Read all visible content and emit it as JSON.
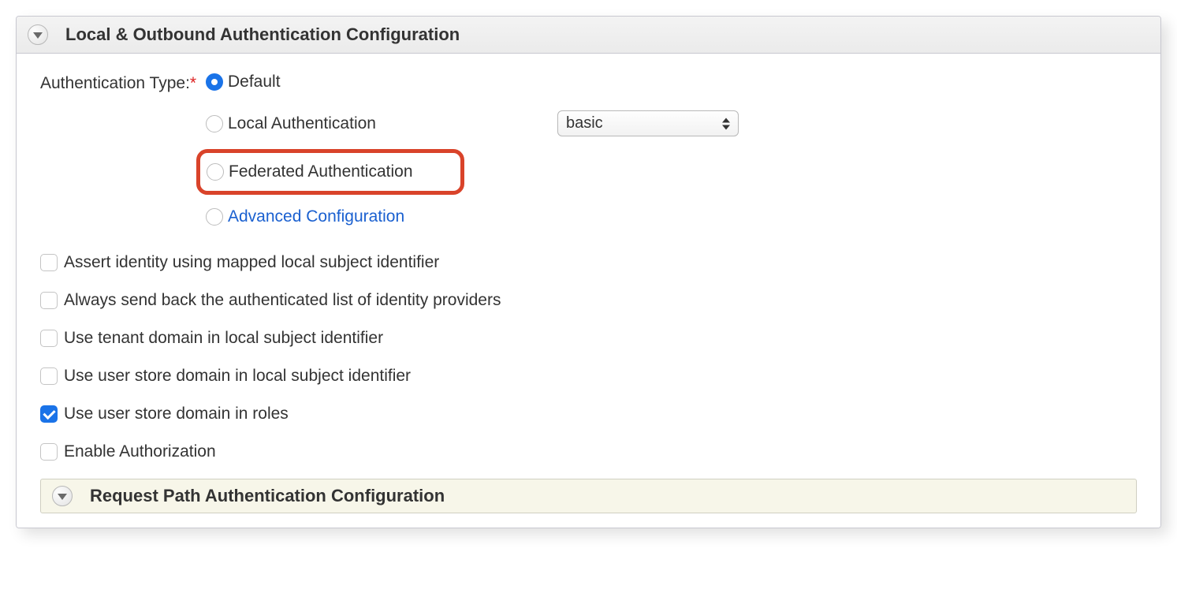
{
  "header": {
    "title": "Local & Outbound Authentication Configuration"
  },
  "form": {
    "auth_type_label": "Authentication Type:",
    "required_mark": "*",
    "options": {
      "default": "Default",
      "local": "Local Authentication",
      "federated": "Federated Authentication",
      "advanced": "Advanced Configuration"
    },
    "selected_option": "default",
    "local_select_value": "basic"
  },
  "checkboxes": [
    {
      "key": "assert_identity",
      "label": "Assert identity using mapped local subject identifier",
      "checked": false
    },
    {
      "key": "send_idp_list",
      "label": "Always send back the authenticated list of identity providers",
      "checked": false
    },
    {
      "key": "tenant_domain",
      "label": "Use tenant domain in local subject identifier",
      "checked": false
    },
    {
      "key": "userstore_subject",
      "label": "Use user store domain in local subject identifier",
      "checked": false
    },
    {
      "key": "userstore_roles",
      "label": "Use user store domain in roles",
      "checked": true
    },
    {
      "key": "enable_authz",
      "label": "Enable Authorization",
      "checked": false
    }
  ],
  "subheader": {
    "title": "Request Path Authentication Configuration"
  }
}
